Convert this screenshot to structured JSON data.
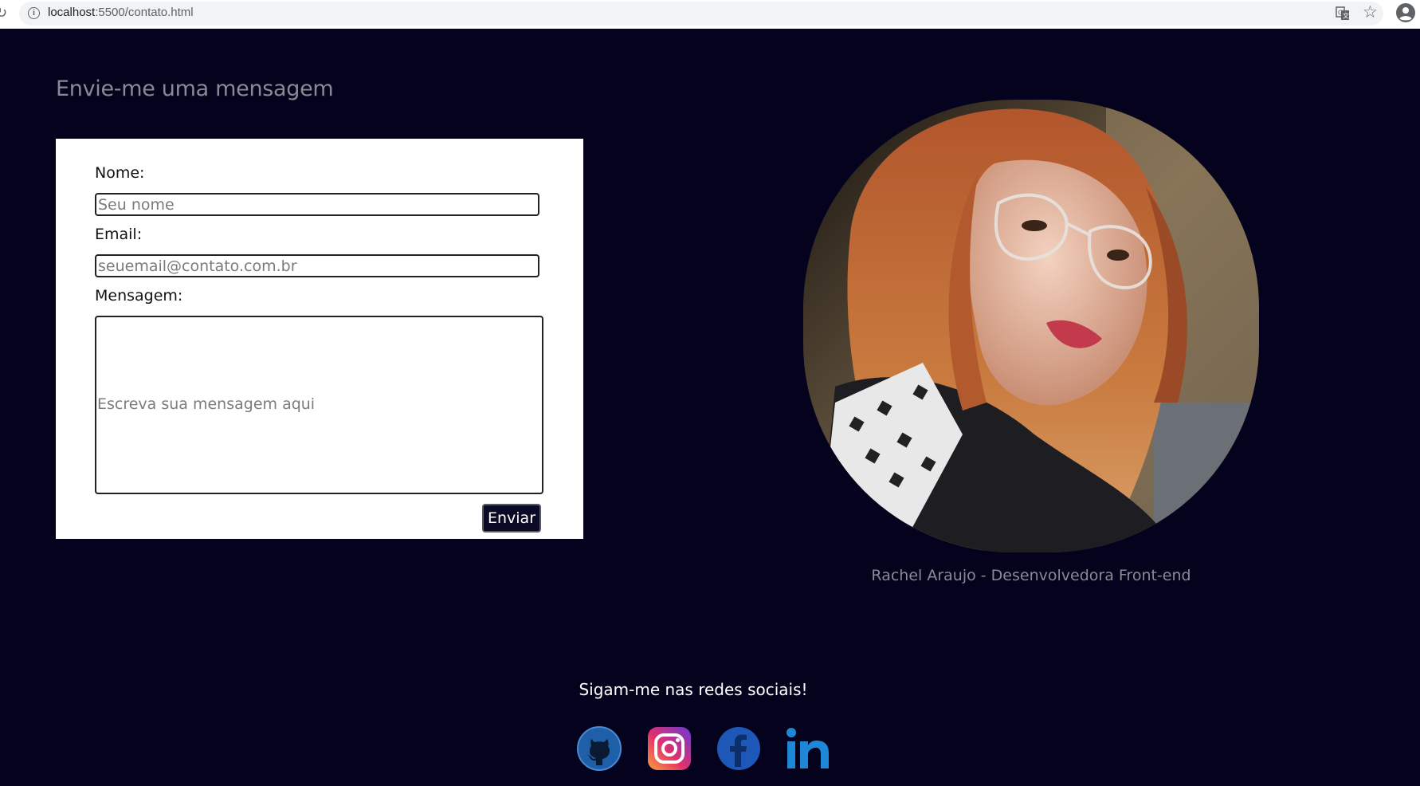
{
  "browser": {
    "url_host": "localhost",
    "url_path": ":5500/contato.html"
  },
  "page": {
    "title": "Envie-me uma mensagem"
  },
  "form": {
    "name_label": "Nome:",
    "name_placeholder": "Seu nome",
    "email_label": "Email:",
    "email_placeholder": "seuemail@contato.com.br",
    "message_label": "Mensagem:",
    "message_placeholder": "Escreva sua mensagem aqui",
    "submit_label": "Enviar"
  },
  "profile": {
    "caption": "Rachel Araujo - Desenvolvedora Front-end"
  },
  "social": {
    "title": "Sigam-me nas redes sociais!",
    "links": [
      "github",
      "instagram",
      "facebook",
      "linkedin"
    ]
  },
  "colors": {
    "background": "#05021e",
    "button": "#0b0a26",
    "card": "#ffffff",
    "muted_text": "#8a8a94"
  }
}
